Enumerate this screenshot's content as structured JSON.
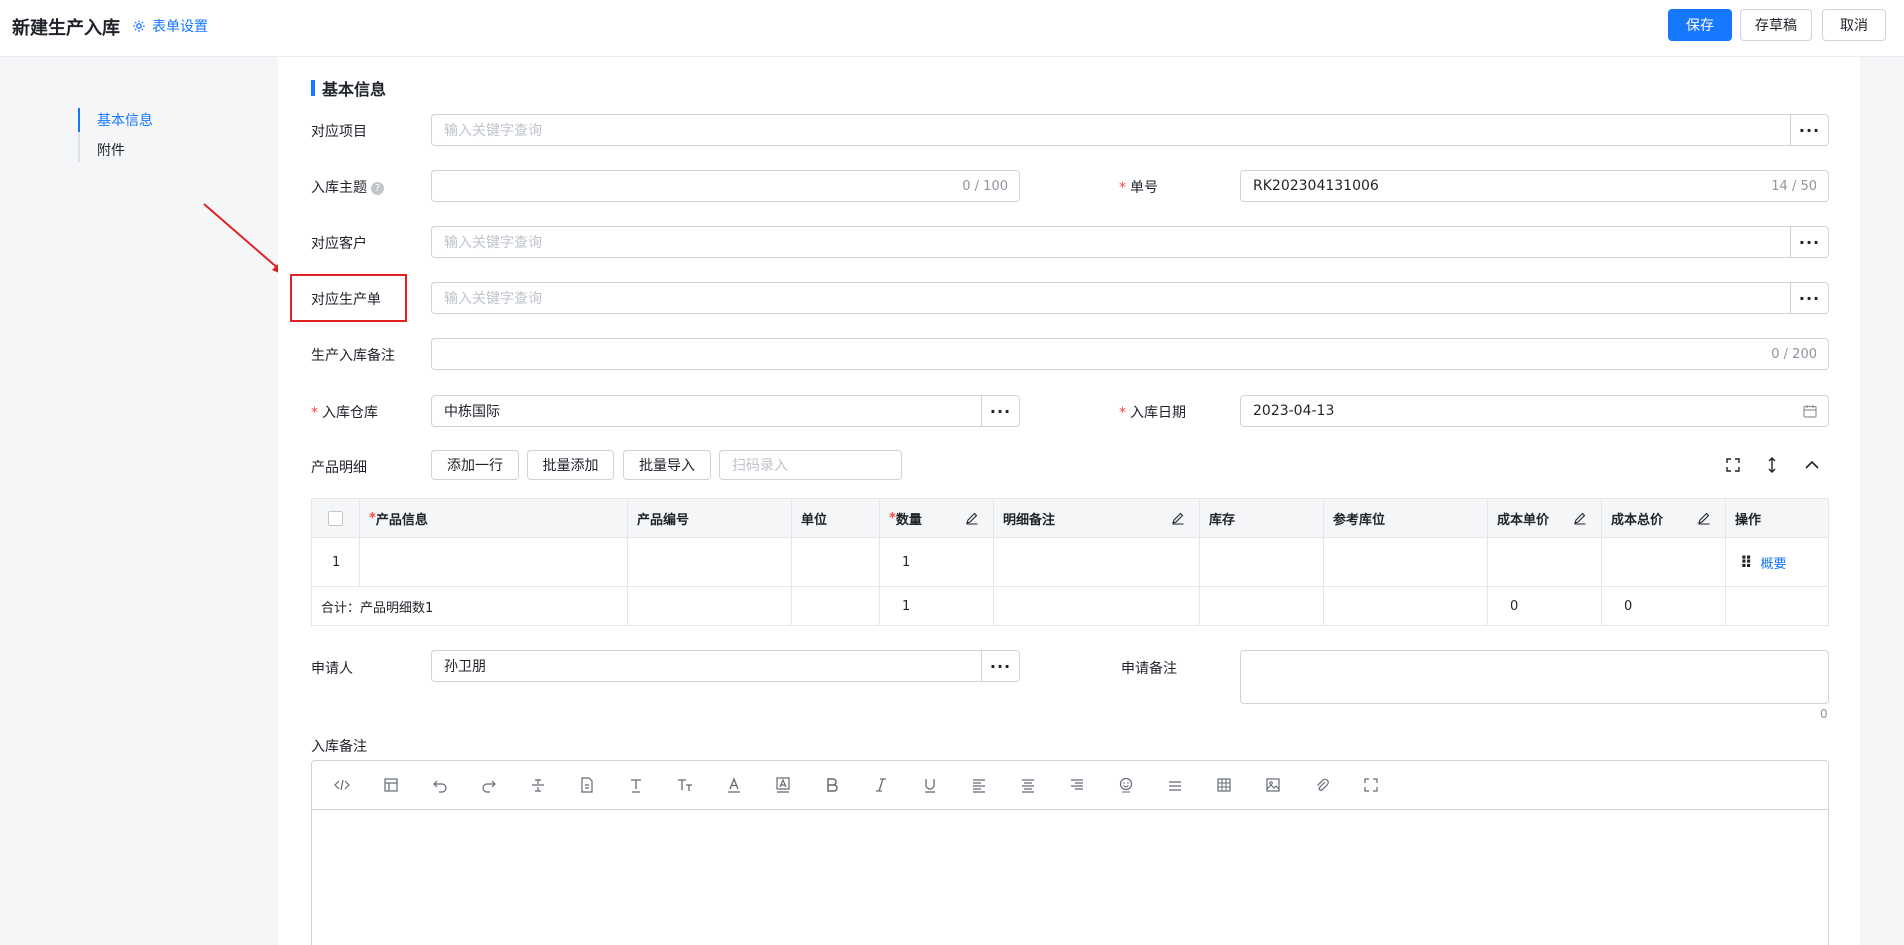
{
  "header": {
    "title": "新建生产入库",
    "form_settings": "表单设置",
    "save": "保存",
    "save_draft": "存草稿",
    "cancel": "取消"
  },
  "sidenav": {
    "items": [
      {
        "label": "基本信息"
      },
      {
        "label": "附件"
      }
    ]
  },
  "section": {
    "title": "基本信息"
  },
  "fields": {
    "project": {
      "label": "对应项目",
      "placeholder": "输入关键字查询"
    },
    "subject": {
      "label": "入库主题",
      "value": "",
      "count": "0 / 100"
    },
    "order_no": {
      "label": "单号",
      "value": "RK202304131006",
      "count": "14 / 50"
    },
    "customer": {
      "label": "对应客户",
      "placeholder": "输入关键字查询"
    },
    "production_order": {
      "label": "对应生产单",
      "placeholder": "输入关键字查询"
    },
    "remark": {
      "label": "生产入库备注",
      "value": "",
      "count": "0 / 200"
    },
    "warehouse": {
      "label": "入库仓库",
      "value": "中栋国际"
    },
    "date": {
      "label": "入库日期",
      "value": "2023-04-13"
    },
    "applicant": {
      "label": "申请人",
      "value": "孙卫朋"
    },
    "apply_remark": {
      "label": "申请备注",
      "count": "0"
    },
    "stock_remark": {
      "label": "入库备注"
    }
  },
  "products": {
    "label": "产品明细",
    "add_row": "添加一行",
    "batch_add": "批量添加",
    "batch_import": "批量导入",
    "scan_placeholder": "扫码录入",
    "columns": [
      "产品信息",
      "产品编号",
      "单位",
      "数量",
      "明细备注",
      "库存",
      "参考库位",
      "成本单价",
      "成本总价",
      "操作"
    ],
    "rows": [
      {
        "index": "1",
        "qty": "1",
        "action": "概要"
      }
    ],
    "total": {
      "label": "合计：产品明细数1",
      "qty": "1",
      "unit_cost": "0",
      "total_cost": "0"
    }
  },
  "editor": {
    "tools": [
      "code-icon",
      "template-icon",
      "undo-icon",
      "redo-icon",
      "strikethrough-icon",
      "format-icon",
      "font-size-icon",
      "text-style-icon",
      "font-color-icon",
      "background-color-icon",
      "bold-icon",
      "italic-icon",
      "underline-icon",
      "align-left-icon",
      "align-center-icon",
      "align-right-icon",
      "emoji-icon",
      "horizontal-rule-icon",
      "table-icon",
      "image-icon",
      "attachment-icon",
      "fullscreen-icon"
    ]
  },
  "colors": {
    "primary": "#1677ff",
    "required": "#f54a45",
    "highlight": "#e02222"
  }
}
